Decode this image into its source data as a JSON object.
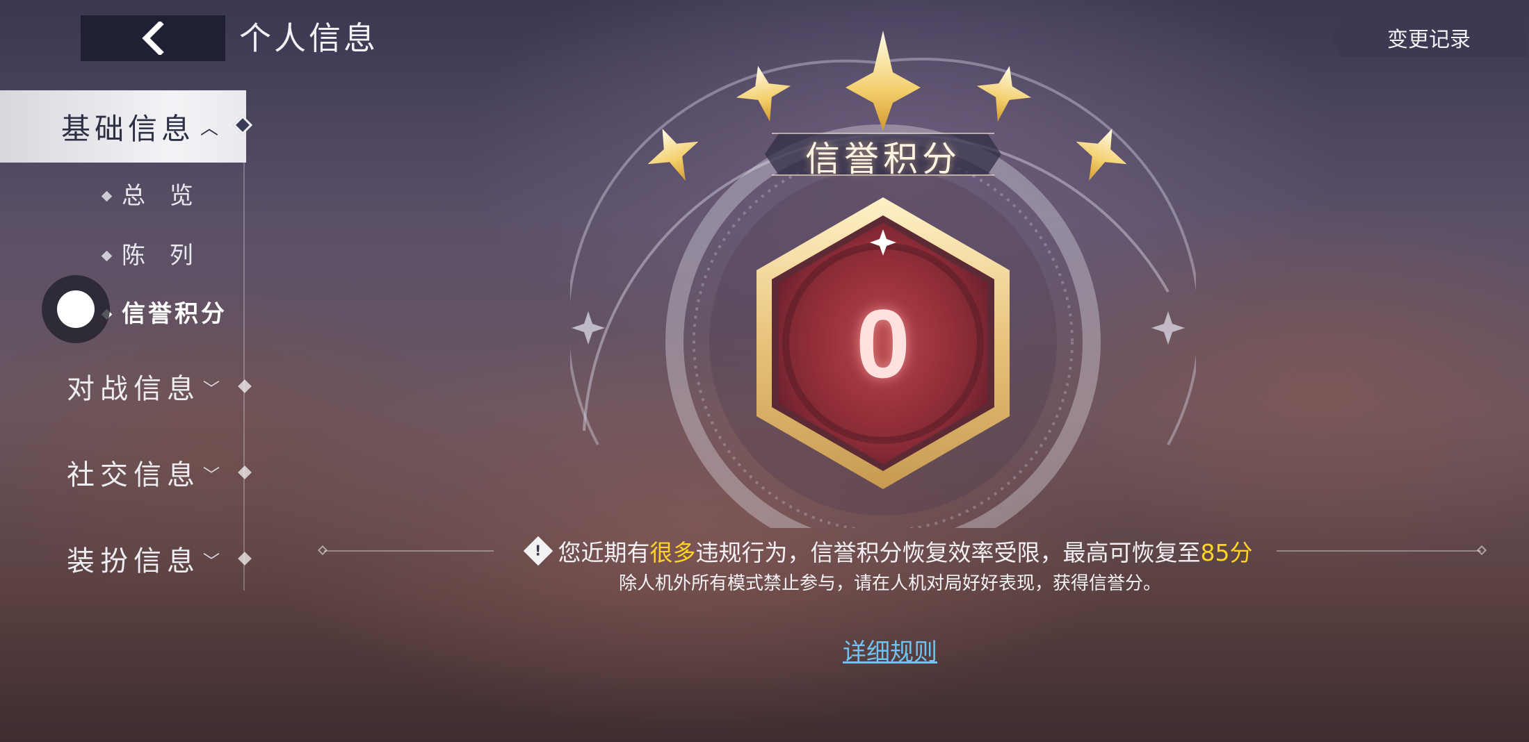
{
  "header": {
    "title": "个人信息",
    "history_button": "变更记录"
  },
  "nav": {
    "active_group": "基础信息",
    "sub_items": [
      {
        "label": "总 览"
      },
      {
        "label": "陈 列"
      },
      {
        "label": "信誉积分"
      }
    ],
    "groups": [
      {
        "label": "对战信息"
      },
      {
        "label": "社交信息"
      },
      {
        "label": "装扮信息"
      }
    ]
  },
  "credit": {
    "title": "信誉积分",
    "score": "0",
    "stars": 5
  },
  "notice": {
    "text_1": "您近期有",
    "highlight_1": "很多",
    "text_2": "违规行为，信誉积分恢复效率受限，最高可恢复至",
    "highlight_2": "85分",
    "subtext": "除人机外所有模式禁止参与，请在人机对局好好表现，获得信誉分。",
    "rules_link": "详细规则"
  },
  "colors": {
    "highlight": "#ffd426",
    "link": "#6fc3f0",
    "badge_red": "#a8343c",
    "badge_gold": "#f4d89a"
  }
}
